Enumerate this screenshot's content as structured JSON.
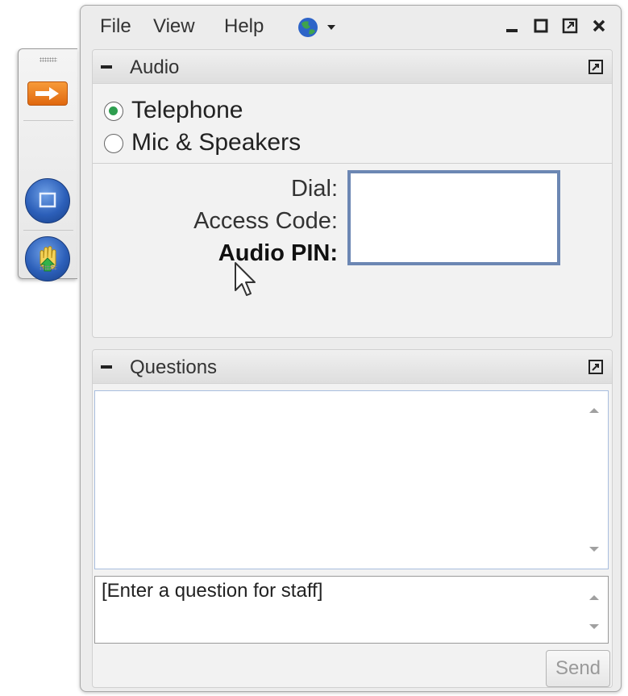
{
  "menu": {
    "file": "File",
    "view": "View",
    "help": "Help"
  },
  "audio": {
    "title": "Audio",
    "options": [
      {
        "label": "Telephone",
        "selected": true
      },
      {
        "label": "Mic & Speakers",
        "selected": false
      }
    ],
    "fields": {
      "dial": "Dial:",
      "access_code": "Access Code:",
      "audio_pin": "Audio PIN:"
    }
  },
  "questions": {
    "title": "Questions",
    "input_placeholder": "[Enter a question for staff]",
    "send_label": "Send"
  },
  "colors": {
    "radio_selected": "#2e9e4f",
    "info_box_border": "#6c87b3",
    "toolbar_arrow_button": "#e0680f",
    "toolbar_circle_button": "#2c5fb9"
  },
  "icons": {
    "toolbar": [
      "arrow-icon",
      "share-screen-icon",
      "raise-hand-icon"
    ],
    "language": "globe-icon",
    "window_controls": [
      "minimize-icon",
      "maximize-icon",
      "restore-icon",
      "close-icon"
    ]
  }
}
